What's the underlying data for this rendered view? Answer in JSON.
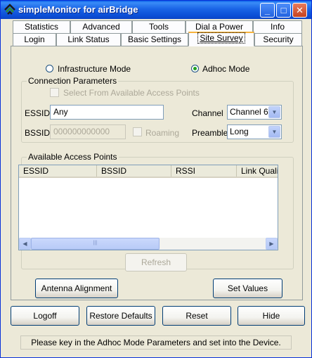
{
  "window": {
    "title": "simpleMonitor for airBridge",
    "minimize_icon": "minimize-icon",
    "maximize_icon": "maximize-icon",
    "close_icon": "close-icon"
  },
  "tabs_row1": [
    "Statistics",
    "Advanced",
    "Tools",
    "Dial a Power",
    "Info"
  ],
  "tabs_row2": [
    "Login",
    "Link Status",
    "Basic Settings",
    "Site Survey",
    "Security"
  ],
  "active_tab": "Site Survey",
  "mode": {
    "infrastructure_label": "Infrastructure Mode",
    "adhoc_label": "Adhoc Mode",
    "selected": "Adhoc Mode"
  },
  "connection": {
    "group_title": "Connection Parameters",
    "select_ap_label": "Select From Available Access Points",
    "essid_label": "ESSID",
    "essid_value": "Any",
    "bssid_label": "BSSID",
    "bssid_value": "000000000000",
    "roaming_label": "Roaming",
    "channel_label": "Channel",
    "channel_value": "Channel 6",
    "preamble_label": "Preamble",
    "preamble_value": "Long"
  },
  "access_points": {
    "group_title": "Available Access Points",
    "columns": [
      "ESSID",
      "BSSID",
      "RSSI",
      "Link Quality"
    ],
    "rows": [],
    "refresh_label": "Refresh"
  },
  "panel_buttons": {
    "antenna_label": "Antenna Alignment",
    "set_values_label": "Set Values"
  },
  "bottom_buttons": {
    "logoff_label": "Logoff",
    "restore_label": "Restore Defaults",
    "reset_label": "Reset",
    "hide_label": "Hide"
  },
  "status_text": "Please key in the Adhoc Mode Parameters and set into the Device.",
  "colors": {
    "titlebar": "#0c4fd7",
    "accent_tab": "#f7b33c",
    "group_title": "#0046d5"
  }
}
